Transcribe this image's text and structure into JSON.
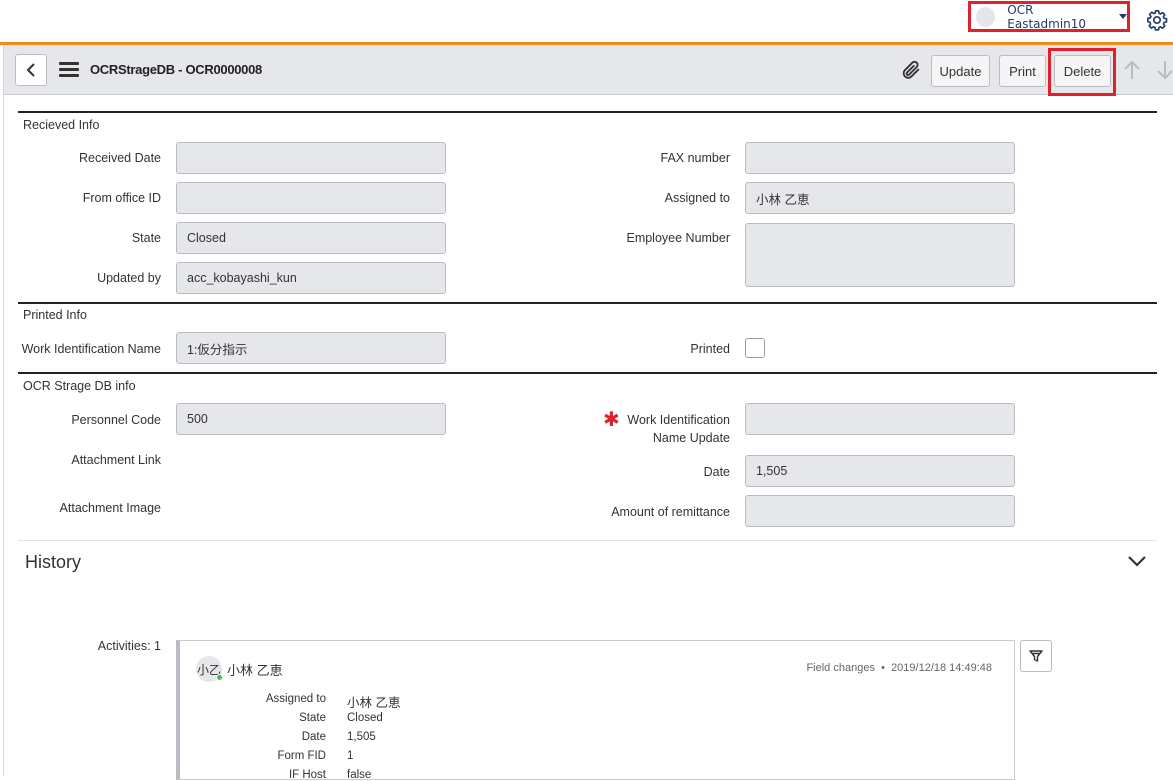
{
  "user": {
    "name": "OCR Eastadmin10"
  },
  "header": {
    "title": "OCRStrageDB - OCR0000008",
    "update_label": "Update",
    "print_label": "Print",
    "delete_label": "Delete"
  },
  "sections": {
    "received": {
      "title": "Recieved Info",
      "received_date": {
        "label": "Received Date",
        "value": ""
      },
      "from_office": {
        "label": "From office ID",
        "value": ""
      },
      "state": {
        "label": "State",
        "value": "Closed"
      },
      "updated_by": {
        "label": "Updated by",
        "value": "acc_kobayashi_kun"
      },
      "fax": {
        "label": "FAX number",
        "value": ""
      },
      "assigned_to": {
        "label": "Assigned to",
        "value": "小林 乙恵"
      },
      "employee_number": {
        "label": "Employee Number",
        "value": ""
      }
    },
    "printed": {
      "title": "Printed Info",
      "work_id_name": {
        "label": "Work Identification Name",
        "value": "1:仮分指示"
      },
      "printed": {
        "label": "Printed",
        "checked": false
      }
    },
    "ocr": {
      "title": "OCR Strage DB info",
      "personnel_code": {
        "label": "Personnel Code",
        "value": "500"
      },
      "attachment_link": {
        "label": "Attachment Link"
      },
      "attachment_image": {
        "label": "Attachment Image"
      },
      "work_id_update": {
        "label_line1": "Work Identification",
        "label_line2": "Name Update",
        "value": "",
        "required_mark": "✱"
      },
      "date": {
        "label": "Date",
        "value": "1,505"
      },
      "amount": {
        "label": "Amount of remittance",
        "value": ""
      }
    }
  },
  "history": {
    "title": "History",
    "activities_label": "Activities: 1",
    "entry": {
      "avatar_text": "小乙",
      "user": "小林 乙恵",
      "type": "Field changes",
      "separator": "•",
      "timestamp": "2019/12/18 14:49:48",
      "changes": [
        {
          "field": "Assigned to",
          "value": "小林 乙恵"
        },
        {
          "field": "State",
          "value": "Closed"
        },
        {
          "field": "Date",
          "value": "1,505"
        },
        {
          "field": "Form FID",
          "value": "1"
        },
        {
          "field": "IF Host",
          "value": "false"
        }
      ]
    }
  },
  "colors": {
    "accent_orange": "#f28a1e",
    "highlight_red": "#e0202a",
    "presence_green": "#4dbb4a"
  }
}
